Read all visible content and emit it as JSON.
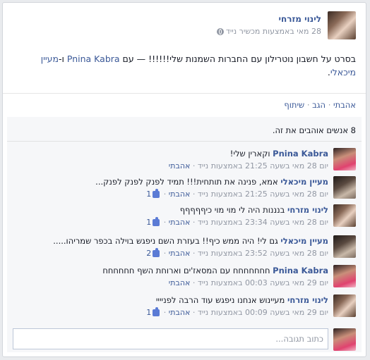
{
  "post": {
    "author": "לינוי מזרחי",
    "meta": "28 מאי באמצעות מכשיר נייד",
    "text_prefix": "בסרט על חשבון נוטרילון עם החברות השמנות שלי!!!!!! — עם",
    "tag1": "Pnina Kabra",
    "tag_join": "ו-",
    "tag2": "מעיין מיכאלי",
    "text_suffix": "."
  },
  "actions": {
    "like": "אהבתי",
    "comment": "הגב",
    "share": "שיתוף",
    "sep": "·"
  },
  "likes_summary": "8 אנשים אוהבים את זה.",
  "comments": [
    {
      "author": "Pnina Kabra",
      "text": "וקארין שלי!",
      "meta": "יום 28 מאי בשעה 21:25 באמצעות נייד",
      "like": "אהבתי",
      "likes": ""
    },
    {
      "author": "מעיין מיכאלי",
      "text": "אמא, פנינה את תותחית!!! תמיד לפנק לפנק לפנק...",
      "meta": "יום 28 מאי בשעה 21:25 באמצעות נייד",
      "like": "אהבתי",
      "likes": "1"
    },
    {
      "author": "לינוי מזרחי",
      "text": "בנננות היה לי מוי מוי כיףףףףף",
      "meta": "יום 28 מאי בשעה 23:34 באמצעות נייד",
      "like": "אהבתי",
      "likes": "1"
    },
    {
      "author": "מעיין מיכאלי",
      "text": "גם לי! היה ממש כיף!! בעזרת השם ניפגש בוילה בכפר שמריהו.....",
      "meta": "יום 28 מאי בשעה 23:52 באמצעות נייד",
      "like": "אהבתי",
      "likes": "2"
    },
    {
      "author": "Pnina Kabra",
      "text": "חחחחחחח עם המסאז'ים וארוחת השף חחחחחח",
      "meta": "יום 29 מאי בשעה 00:03 באמצעות נייד",
      "like": "אהבתי",
      "likes": ""
    },
    {
      "author": "לינוי מזרחי",
      "text": "מעיינוש אנחנו ניפגש עוד הרבה לפניייי",
      "meta": "יום 29 מאי בשעה 00:09 באמצעות נייד",
      "like": "אהבתי",
      "likes": "1"
    }
  ],
  "reply": {
    "placeholder": "כתוב תגובה..."
  }
}
